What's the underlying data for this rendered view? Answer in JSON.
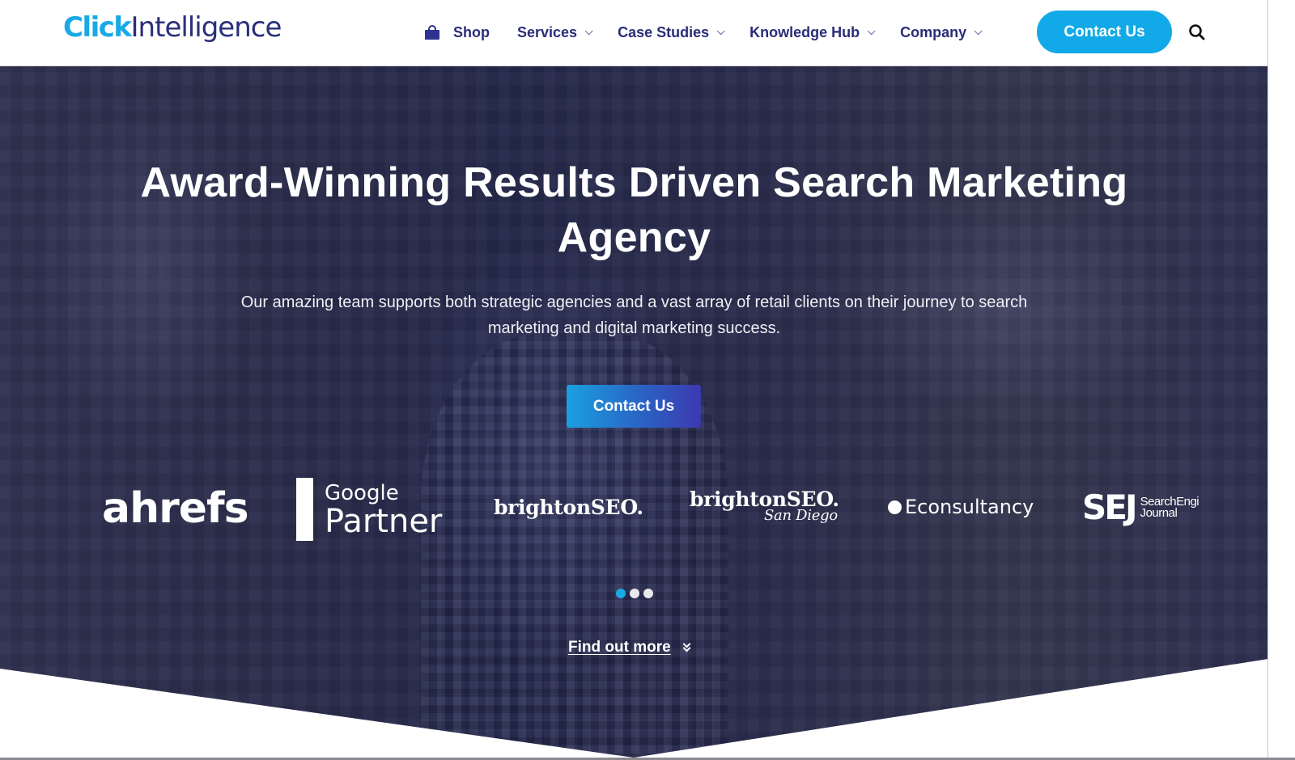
{
  "header": {
    "logo": {
      "part1": "Click",
      "part2": "Intelligence"
    },
    "nav": [
      {
        "label": "Shop",
        "icon": "shopping-bag-icon",
        "has_dropdown": false
      },
      {
        "label": "Services",
        "has_dropdown": true
      },
      {
        "label": "Case Studies",
        "has_dropdown": true
      },
      {
        "label": "Knowledge Hub",
        "has_dropdown": true
      },
      {
        "label": "Company",
        "has_dropdown": true
      }
    ],
    "contact_label": "Contact Us",
    "search_icon": "search-icon"
  },
  "hero": {
    "title": "Award-Winning Results Driven Search Marketing Agency",
    "subtitle": "Our amazing team supports both strategic agencies and a vast array of retail clients on their journey to search marketing and digital marketing success.",
    "cta_label": "Contact Us",
    "logos": {
      "ahrefs": "ahrefs",
      "google_line1": "Google",
      "google_line2": "Partner",
      "brighton": "brightonSEO.",
      "brighton_sd": "brightonSEO.",
      "brighton_sd_sub": "San Diego",
      "econsultancy": "Econsultancy",
      "sej_big": "SEJ",
      "sej_line1": "SearchEngi",
      "sej_line2": "Journal"
    },
    "carousel": {
      "pages": 3,
      "active_index": 0
    },
    "find_more_label": "Find out more"
  },
  "colors": {
    "brand_blue": "#18a9e6",
    "brand_navy": "#2a2d78",
    "hero_overlay": "#2b2d4b",
    "cta_gradient_start": "#1aa0e0",
    "cta_gradient_end": "#3d3ab0"
  }
}
